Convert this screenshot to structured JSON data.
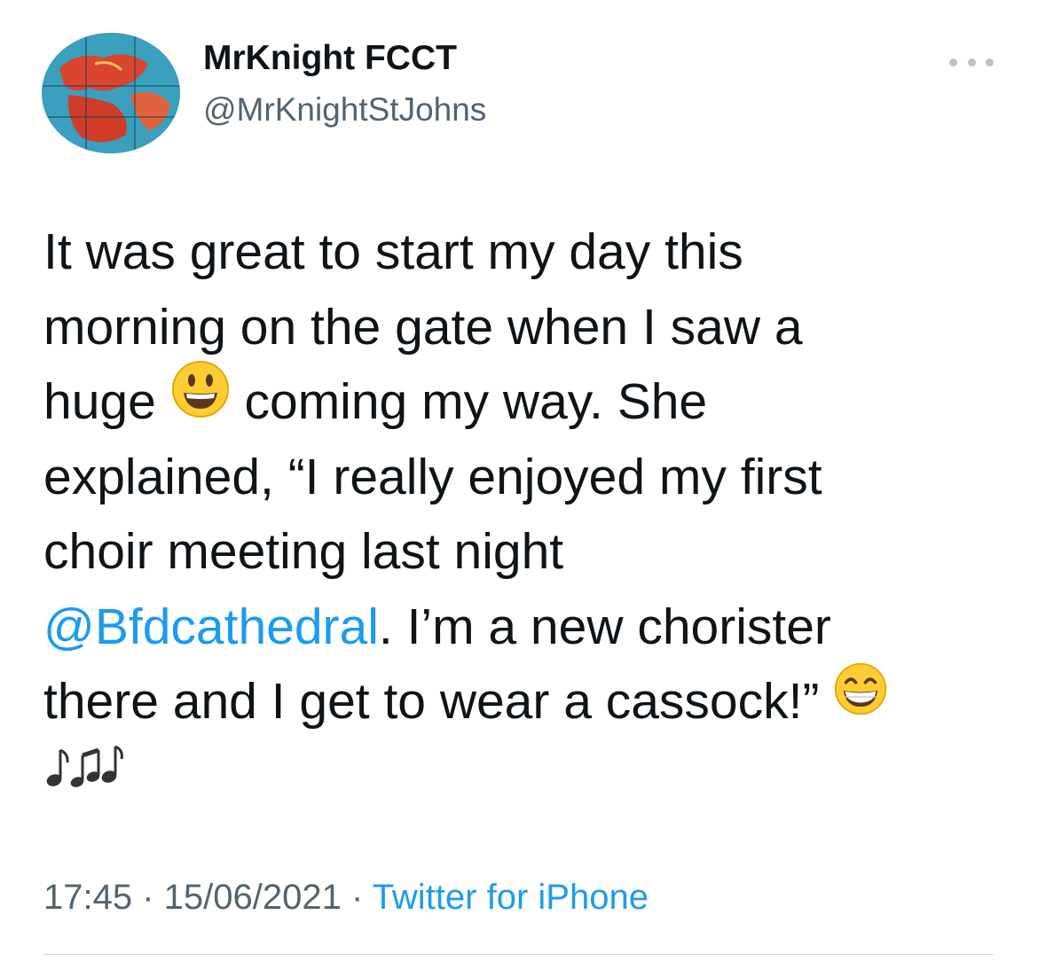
{
  "author": {
    "display_name": "MrKnight FCCT",
    "handle": "@MrKnightStJohns",
    "avatar_icon": "globe-map-avatar"
  },
  "menu": {
    "icon": "more-options-icon"
  },
  "tweet": {
    "line1": "It was great to start my day this",
    "line2": "morning on the gate when I saw a",
    "line3_a": "huge",
    "line3_emoji": "smiley-face-emoji",
    "line3_b": "coming my way. She",
    "line4": "explained, “I really enjoyed my first",
    "line5": "choir meeting last night",
    "mention": "@Bfdcathedral",
    "line6_rest": ". I’m a new chorister",
    "line7": "there and I get to wear a cassock!”",
    "line7_emoji": "grinning-face-emoji",
    "line8_emoji": "musical-notes-emoji"
  },
  "meta": {
    "time": "17:45",
    "sep1": " · ",
    "date": "15/06/2021",
    "sep2": " · ",
    "source": "Twitter for iPhone"
  },
  "colors": {
    "link": "#1d9bf0",
    "text": "#0f1419",
    "secondary": "#536471"
  }
}
